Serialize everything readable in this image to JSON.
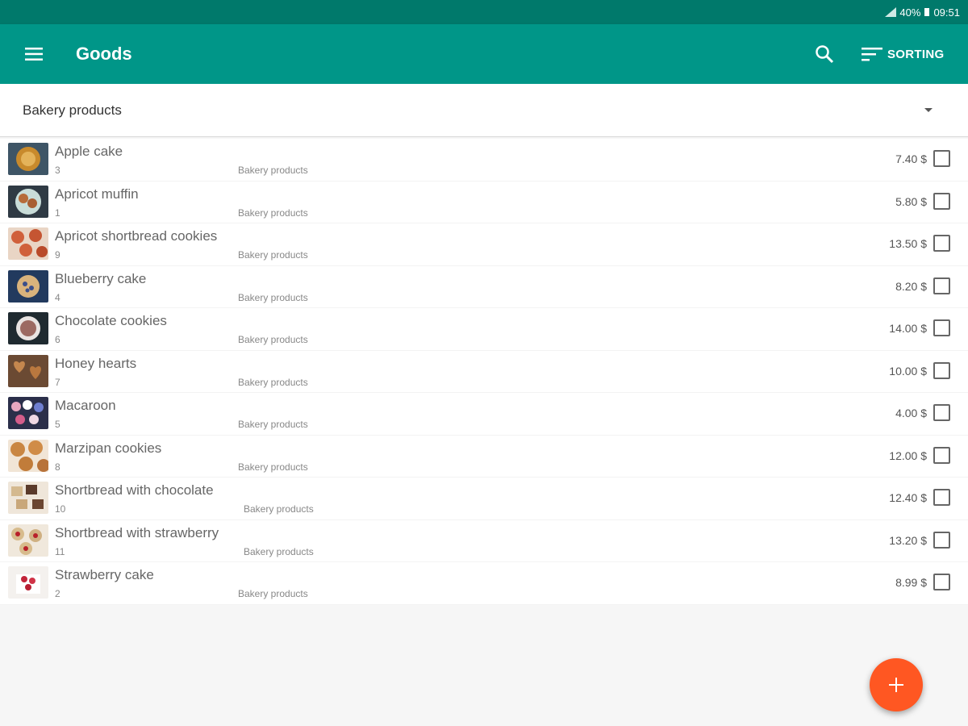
{
  "status_bar": {
    "battery": "40%",
    "time": "09:51",
    "icons": [
      "signal-icon",
      "battery-icon"
    ]
  },
  "app_bar": {
    "title": "Goods",
    "sort_label": "SORTING",
    "icons": {
      "menu": "menu-icon",
      "search": "search-icon",
      "sort": "sort-icon"
    }
  },
  "category_filter": {
    "selected": "Bakery products"
  },
  "products": [
    {
      "name": "Apple cake",
      "qty": "3",
      "category": "Bakery products",
      "price": "7.40 $"
    },
    {
      "name": "Apricot muffin",
      "qty": "1",
      "category": "Bakery products",
      "price": "5.80 $"
    },
    {
      "name": "Apricot shortbread cookies",
      "qty": "9",
      "category": "Bakery products",
      "price": "13.50 $"
    },
    {
      "name": "Blueberry cake",
      "qty": "4",
      "category": "Bakery products",
      "price": "8.20 $"
    },
    {
      "name": "Chocolate cookies",
      "qty": "6",
      "category": "Bakery products",
      "price": "14.00 $"
    },
    {
      "name": "Honey hearts",
      "qty": "7",
      "category": "Bakery products",
      "price": "10.00 $"
    },
    {
      "name": "Macaroon",
      "qty": "5",
      "category": "Bakery products",
      "price": "4.00 $"
    },
    {
      "name": "Marzipan cookies",
      "qty": "8",
      "category": "Bakery products",
      "price": "12.00 $"
    },
    {
      "name": "Shortbread with chocolate",
      "qty": "10",
      "category": "Bakery products",
      "price": "12.40 $"
    },
    {
      "name": "Shortbread with strawberry",
      "qty": "11",
      "category": "Bakery products",
      "price": "13.20 $"
    },
    {
      "name": "Strawberry cake",
      "qty": "2",
      "category": "Bakery products",
      "price": "8.99 $"
    }
  ],
  "colors": {
    "primary": "#009688",
    "primary_dark": "#00796b",
    "accent": "#ff5722"
  },
  "fab": {
    "icon": "plus-icon"
  }
}
